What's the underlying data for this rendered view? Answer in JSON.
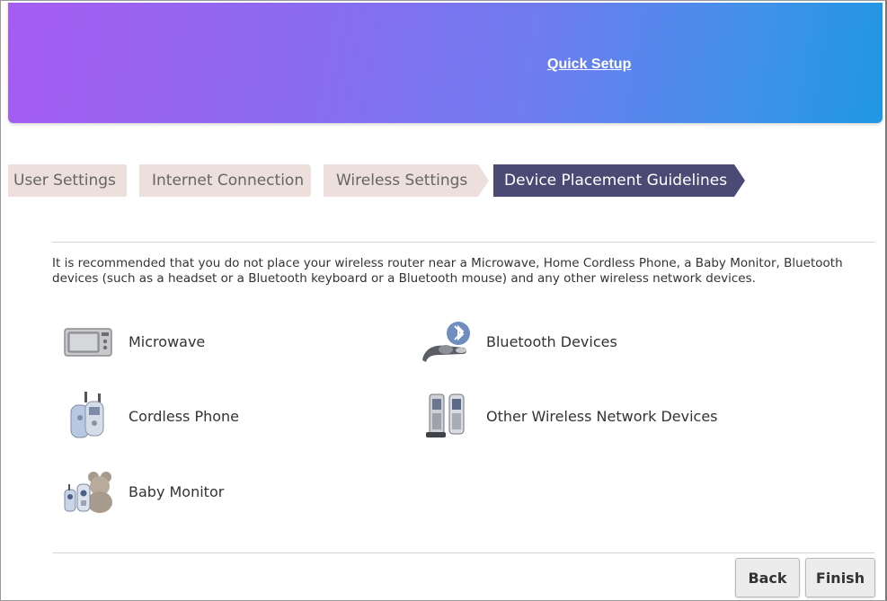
{
  "header": {
    "title": "Quick Setup"
  },
  "steps": [
    {
      "label": "User Settings",
      "active": false
    },
    {
      "label": "Internet Connection",
      "active": false
    },
    {
      "label": "Wireless Settings",
      "active": false
    },
    {
      "label": "Device Placement Guidelines",
      "active": true
    }
  ],
  "intro": "It is recommended that you do not place your wireless router near a Microwave, Home Cordless Phone, a Baby Monitor, Bluetooth devices (such as a headset or a Bluetooth keyboard or a Bluetooth mouse) and any other wireless network devices.",
  "devices": [
    {
      "label": "Microwave",
      "icon": "microwave-icon"
    },
    {
      "label": "Bluetooth Devices",
      "icon": "bluetooth-headset-icon"
    },
    {
      "label": "Cordless Phone",
      "icon": "cordless-phone-icon"
    },
    {
      "label": "Other Wireless Network Devices",
      "icon": "mobile-phones-icon"
    },
    {
      "label": "Baby Monitor",
      "icon": "baby-monitor-icon"
    }
  ],
  "buttons": {
    "back": "Back",
    "finish": "Finish"
  },
  "colors": {
    "active_step": "#4a4a75",
    "inactive_step": "#ecdfdc",
    "header_start": "#a65cf2",
    "header_end": "#1f97e2"
  }
}
